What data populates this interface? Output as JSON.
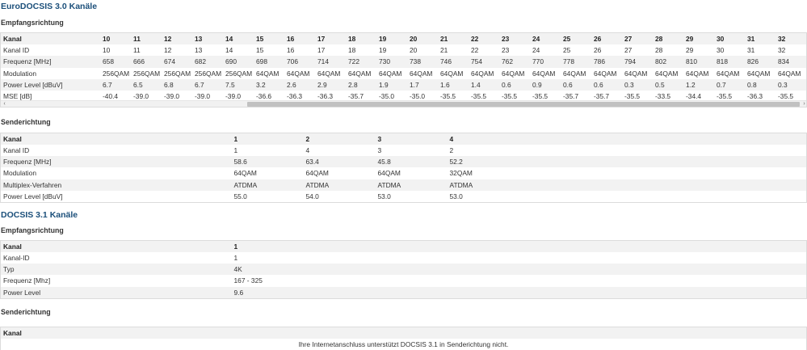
{
  "docsis30": {
    "title": "EuroDOCSIS 3.0 Kanäle",
    "downstream": {
      "heading": "Empfangsrichtung",
      "row_labels": [
        "Kanal",
        "Kanal ID",
        "Frequenz [MHz]",
        "Modulation",
        "Power Level [dBuV]",
        "MSE [dB]"
      ],
      "channels": [
        {
          "kanal": "10",
          "id": "10",
          "freq": "658",
          "mod": "256QAM",
          "power": "6.7",
          "mse": "-40.4"
        },
        {
          "kanal": "11",
          "id": "11",
          "freq": "666",
          "mod": "256QAM",
          "power": "6.5",
          "mse": "-39.0"
        },
        {
          "kanal": "12",
          "id": "12",
          "freq": "674",
          "mod": "256QAM",
          "power": "6.8",
          "mse": "-39.0"
        },
        {
          "kanal": "13",
          "id": "13",
          "freq": "682",
          "mod": "256QAM",
          "power": "6.7",
          "mse": "-39.0"
        },
        {
          "kanal": "14",
          "id": "14",
          "freq": "690",
          "mod": "256QAM",
          "power": "7.5",
          "mse": "-39.0"
        },
        {
          "kanal": "15",
          "id": "15",
          "freq": "698",
          "mod": "64QAM",
          "power": "3.2",
          "mse": "-36.6"
        },
        {
          "kanal": "16",
          "id": "16",
          "freq": "706",
          "mod": "64QAM",
          "power": "2.6",
          "mse": "-36.3"
        },
        {
          "kanal": "17",
          "id": "17",
          "freq": "714",
          "mod": "64QAM",
          "power": "2.9",
          "mse": "-36.3"
        },
        {
          "kanal": "18",
          "id": "18",
          "freq": "722",
          "mod": "64QAM",
          "power": "2.8",
          "mse": "-35.7"
        },
        {
          "kanal": "19",
          "id": "19",
          "freq": "730",
          "mod": "64QAM",
          "power": "1.9",
          "mse": "-35.0"
        },
        {
          "kanal": "20",
          "id": "20",
          "freq": "738",
          "mod": "64QAM",
          "power": "1.7",
          "mse": "-35.0"
        },
        {
          "kanal": "21",
          "id": "21",
          "freq": "746",
          "mod": "64QAM",
          "power": "1.6",
          "mse": "-35.5"
        },
        {
          "kanal": "22",
          "id": "22",
          "freq": "754",
          "mod": "64QAM",
          "power": "1.4",
          "mse": "-35.5"
        },
        {
          "kanal": "23",
          "id": "23",
          "freq": "762",
          "mod": "64QAM",
          "power": "0.6",
          "mse": "-35.5"
        },
        {
          "kanal": "24",
          "id": "24",
          "freq": "770",
          "mod": "64QAM",
          "power": "0.9",
          "mse": "-35.5"
        },
        {
          "kanal": "25",
          "id": "25",
          "freq": "778",
          "mod": "64QAM",
          "power": "0.6",
          "mse": "-35.7"
        },
        {
          "kanal": "26",
          "id": "26",
          "freq": "786",
          "mod": "64QAM",
          "power": "0.6",
          "mse": "-35.7"
        },
        {
          "kanal": "27",
          "id": "27",
          "freq": "794",
          "mod": "64QAM",
          "power": "0.3",
          "mse": "-35.5"
        },
        {
          "kanal": "28",
          "id": "28",
          "freq": "802",
          "mod": "64QAM",
          "power": "0.5",
          "mse": "-33.5"
        },
        {
          "kanal": "29",
          "id": "29",
          "freq": "810",
          "mod": "64QAM",
          "power": "1.2",
          "mse": "-34.4"
        },
        {
          "kanal": "30",
          "id": "30",
          "freq": "818",
          "mod": "64QAM",
          "power": "0.7",
          "mse": "-35.5"
        },
        {
          "kanal": "31",
          "id": "31",
          "freq": "826",
          "mod": "64QAM",
          "power": "0.8",
          "mse": "-36.3"
        },
        {
          "kanal": "32",
          "id": "32",
          "freq": "834",
          "mod": "64QAM",
          "power": "0.3",
          "mse": "-35.5"
        }
      ],
      "scroll_left_icon": "chevron-left-icon",
      "scroll_right_icon": "chevron-right-icon"
    },
    "upstream": {
      "heading": "Senderichtung",
      "row_labels": [
        "Kanal",
        "Kanal ID",
        "Frequenz [MHz]",
        "Modulation",
        "Multiplex-Verfahren",
        "Power Level [dBuV]"
      ],
      "channels": [
        {
          "kanal": "1",
          "id": "1",
          "freq": "58.6",
          "mod": "64QAM",
          "mux": "ATDMA",
          "power": "55.0"
        },
        {
          "kanal": "2",
          "id": "4",
          "freq": "63.4",
          "mod": "64QAM",
          "mux": "ATDMA",
          "power": "54.0"
        },
        {
          "kanal": "3",
          "id": "3",
          "freq": "45.8",
          "mod": "64QAM",
          "mux": "ATDMA",
          "power": "53.0"
        },
        {
          "kanal": "4",
          "id": "2",
          "freq": "52.2",
          "mod": "32QAM",
          "mux": "ATDMA",
          "power": "53.0"
        }
      ]
    }
  },
  "docsis31": {
    "title": "DOCSIS 3.1 Kanäle",
    "downstream": {
      "heading": "Empfangsrichtung",
      "row_labels": [
        "Kanal",
        "Kanal-ID",
        "Typ",
        "Frequenz [Mhz]",
        "Power Level"
      ],
      "values": [
        "1",
        "1",
        "4K",
        "167 - 325",
        "9.6"
      ]
    },
    "upstream": {
      "heading": "Senderichtung",
      "header_label": "Kanal",
      "message": "Ihre Internetanschluss unterstützt DOCSIS 3.1 in Senderichtung nicht."
    }
  },
  "colors": {
    "title": "#1b4f7a",
    "row_stripe": "#f2f2f2",
    "border": "#dcdcdc"
  }
}
